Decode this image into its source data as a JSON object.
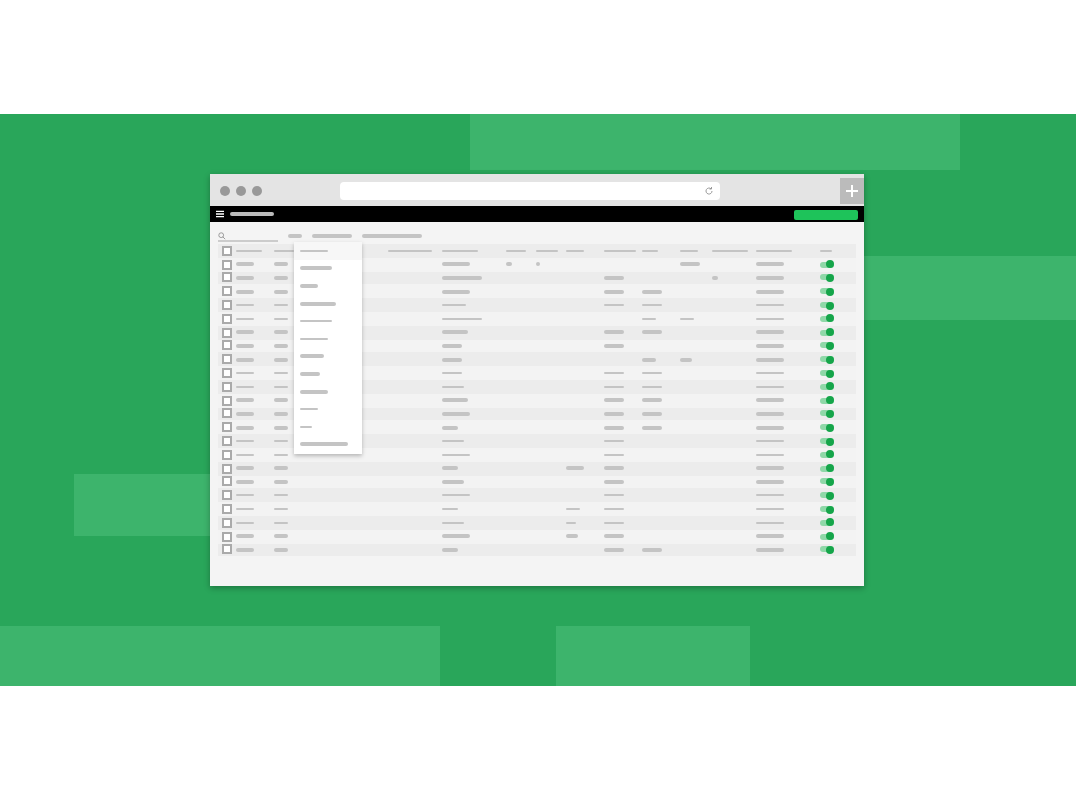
{
  "header": {
    "checked": false
  },
  "rows": [
    {
      "checked": false,
      "on": true
    },
    {
      "checked": false,
      "on": true
    },
    {
      "checked": false,
      "on": true
    },
    {
      "checked": false,
      "on": true
    },
    {
      "checked": false,
      "on": true
    },
    {
      "checked": false,
      "on": true
    },
    {
      "checked": false,
      "on": true
    },
    {
      "checked": false,
      "on": true
    },
    {
      "checked": false,
      "on": true
    },
    {
      "checked": false,
      "on": true
    },
    {
      "checked": false,
      "on": true
    },
    {
      "checked": false,
      "on": true
    },
    {
      "checked": false,
      "on": true
    },
    {
      "checked": false,
      "on": true
    },
    {
      "checked": false,
      "on": true
    },
    {
      "checked": false,
      "on": true
    },
    {
      "checked": false,
      "on": true
    },
    {
      "checked": false,
      "on": true
    },
    {
      "checked": false,
      "on": true
    },
    {
      "checked": false,
      "on": true
    },
    {
      "checked": false,
      "on": true
    },
    {
      "checked": false,
      "on": true
    }
  ]
}
